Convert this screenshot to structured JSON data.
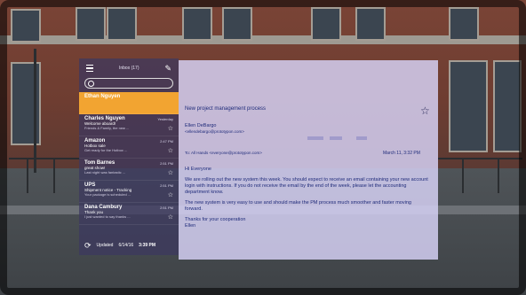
{
  "inbox": {
    "title": "Inbox (17)",
    "items": [
      {
        "sender": "Ethan Nguyen",
        "subject": "",
        "preview": "",
        "time": ""
      },
      {
        "sender": "Charles Nguyen",
        "subject": "Welcome aboard!",
        "preview": "Friends & Family, the new ...",
        "time": "Yesterday"
      },
      {
        "sender": "Amazon",
        "subject": "Hotbox sale",
        "preview": "Get ready for the Hotbox ...",
        "time": "2:47 PM"
      },
      {
        "sender": "Tom Barnes",
        "subject": "great show!",
        "preview": "Last night was fantastic ...",
        "time": "2:51 PM"
      },
      {
        "sender": "UPS",
        "subject": "Shipment notice - Tracking",
        "preview": "Your package is scheduled ...",
        "time": "2:51 PM"
      },
      {
        "sender": "Dana Cambury",
        "subject": "Thank you",
        "preview": "I just wanted to say thanks ...",
        "time": "2:51 PM"
      }
    ],
    "updated_label": "Updated",
    "updated_date": "6/14/16",
    "updated_time": "3:39 PM"
  },
  "email": {
    "subject": "New project management process",
    "from_name": "Ellen DeBargo",
    "from_addr": "<ellendebargo@prototypon.com>",
    "to": "To: All Hands <everyone@prototypon.com>",
    "date": "March 11, 3:32 PM",
    "greeting": "Hi Everyone",
    "para1": "We are rolling out the new system this week. You should expect to receive an email containing your new account login with instructions. If you do not receive the email by the end of the week, please let the accounting department know.",
    "para2": "The new system is very easy to use and should make the PM process much smoother and faster moving forward.",
    "closing": "Thanks for your cooperation",
    "signature": "Ellen"
  },
  "icons": {
    "menu": "menu-icon",
    "compose": "compose-icon",
    "search": "search-icon",
    "star": "star-icon",
    "refresh": "refresh-icon"
  },
  "colors": {
    "selected": "#f2a431",
    "panel": "#3c375f",
    "reader": "#d7d2f5",
    "text": "#1f2b7a"
  }
}
